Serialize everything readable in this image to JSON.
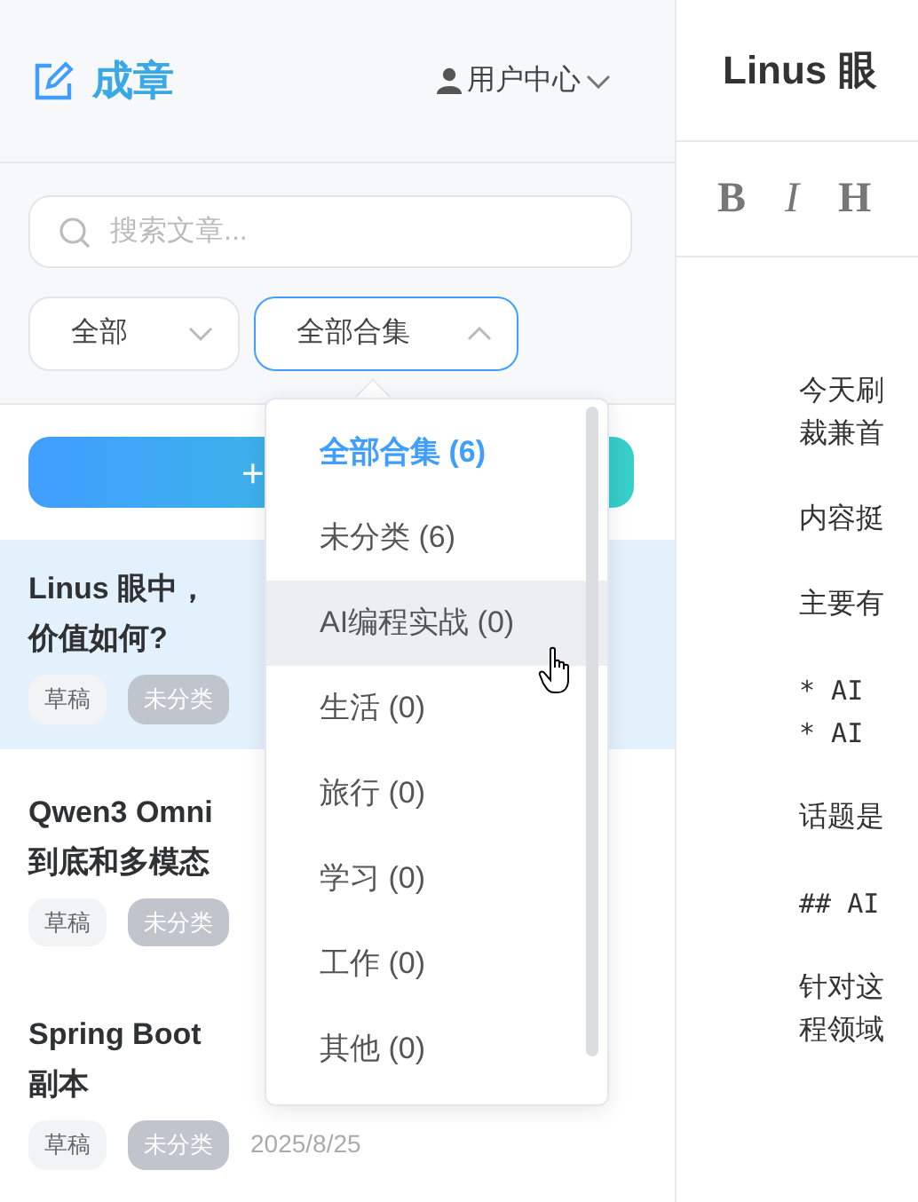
{
  "app": {
    "logo": "成章",
    "user_menu": "用户中心"
  },
  "search": {
    "placeholder": "搜索文章..."
  },
  "filters": [
    {
      "label": "全部",
      "expanded": false
    },
    {
      "label": "全部合集",
      "expanded": true
    }
  ],
  "new_button": "+",
  "articles": [
    {
      "title_lines": [
        "Linus 眼中，",
        "价值如何?"
      ],
      "selected": true,
      "tags": [
        {
          "label": "草稿",
          "kind": "status"
        },
        {
          "label": "未分类",
          "kind": "category"
        }
      ]
    },
    {
      "title_lines": [
        "Qwen3 Omni",
        "到底和多模态"
      ],
      "selected": false,
      "tags": [
        {
          "label": "草稿",
          "kind": "status"
        },
        {
          "label": "未分类",
          "kind": "category"
        }
      ]
    },
    {
      "title_lines": [
        "Spring Boot",
        "副本"
      ],
      "selected": false,
      "tags": [
        {
          "label": "草稿",
          "kind": "status"
        },
        {
          "label": "未分类",
          "kind": "category"
        }
      ],
      "date": "2025/8/25"
    }
  ],
  "collection_menu": {
    "items": [
      {
        "label": "全部合集 (6)",
        "selected": true,
        "hovered": false
      },
      {
        "label": "未分类 (6)",
        "selected": false,
        "hovered": false
      },
      {
        "label": "AI编程实战 (0)",
        "selected": false,
        "hovered": true
      },
      {
        "label": "生活 (0)",
        "selected": false,
        "hovered": false
      },
      {
        "label": "旅行 (0)",
        "selected": false,
        "hovered": false
      },
      {
        "label": "学习 (0)",
        "selected": false,
        "hovered": false
      },
      {
        "label": "工作 (0)",
        "selected": false,
        "hovered": false
      },
      {
        "label": "其他 (0)",
        "selected": false,
        "hovered": false
      }
    ]
  },
  "editor": {
    "title": "Linus 眼",
    "toolbar": [
      {
        "label": "B",
        "kind": "bold"
      },
      {
        "label": "I",
        "kind": "italic"
      },
      {
        "label": "H",
        "kind": "heading"
      }
    ],
    "paragraphs": [
      {
        "kind": "text",
        "lines": [
          "今天刷",
          "裁兼首"
        ]
      },
      {
        "kind": "text",
        "lines": [
          "内容挺"
        ]
      },
      {
        "kind": "text",
        "lines": [
          "主要有"
        ]
      },
      {
        "kind": "code",
        "lines": [
          "* AI",
          "* AI"
        ]
      },
      {
        "kind": "text",
        "lines": [
          "话题是"
        ]
      },
      {
        "kind": "code",
        "lines": [
          "## AI"
        ]
      },
      {
        "kind": "text",
        "lines": [
          "针对这",
          "程领域"
        ]
      }
    ]
  }
}
